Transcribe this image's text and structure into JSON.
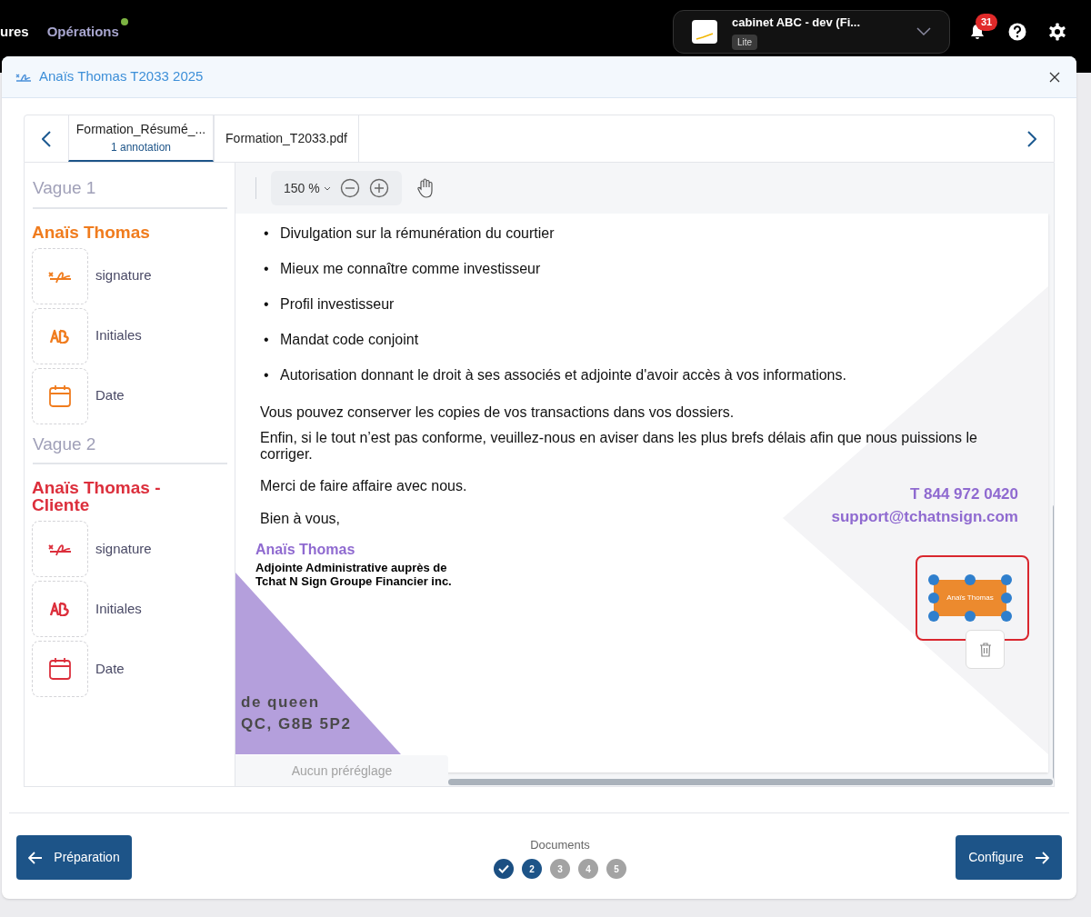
{
  "topbar": {
    "nav": [
      {
        "label": "ures",
        "dot": false
      },
      {
        "label": "Opérations",
        "dot": true
      }
    ],
    "account": {
      "name": "cabinet ABC - dev (Fi...",
      "plan": "Lite"
    },
    "notifications": "31"
  },
  "dialog": {
    "title": "Anaïs Thomas T2033 2025"
  },
  "tabs": [
    {
      "label": "Formation_Résumé_...",
      "sub": "1 annotation",
      "selected": true
    },
    {
      "label": "Formation_T2033.pdf",
      "selected": false
    }
  ],
  "waves": [
    {
      "title": "Vague 1",
      "signers": [
        {
          "name": "Anaïs Thomas",
          "color": "#f07c1e",
          "fields": [
            {
              "kind": "signature",
              "label": "signature"
            },
            {
              "kind": "initials",
              "label": "Initiales"
            },
            {
              "kind": "date",
              "label": "Date"
            }
          ]
        }
      ]
    },
    {
      "title": "Vague 2",
      "signers": [
        {
          "name": "Anaïs Thomas - Cliente",
          "color": "#dc2f3c",
          "fields": [
            {
              "kind": "signature",
              "label": "signature"
            },
            {
              "kind": "initials",
              "label": "Initiales"
            },
            {
              "kind": "date",
              "label": "Date"
            }
          ]
        }
      ]
    }
  ],
  "toolbar": {
    "zoom": "150 %"
  },
  "document": {
    "bullets": [
      {
        "marker": "•",
        "text": "Divulgation sur la rémunération du courtier"
      },
      {
        "marker": "•",
        "text": "Mieux me connaître comme investisseur"
      },
      {
        "marker": "•",
        "text": "Profil investisseur"
      },
      {
        "marker": "•",
        "text": "Mandat code conjoint"
      },
      {
        "marker": "•",
        "text": "Autorisation donnant le droit à ses associés et adjointe d'avoir accès à vos informations."
      }
    ],
    "paragraphs": [
      "Vous pouvez conserver les copies de vos transactions dans vos dossiers.",
      "Enfin, si le tout n’est pas conforme, veuillez-nous en aviser dans les plus brefs délais afin que nous puissions le corriger."
    ],
    "closing": [
      "Merci de faire affaire avec nous.",
      "Bien à vous,"
    ],
    "signer_name": "Anaïs Thomas",
    "signer_title": [
      "Adjointe Administrative auprès de",
      "Tchat N Sign Groupe Financier inc."
    ],
    "contact": [
      "T 844 972 0420",
      "support@tchatnsign.com"
    ],
    "address": [
      "de queen",
      "QC, G8B 5P2"
    ],
    "annotation": {
      "label": "Anaïs Thomas",
      "selected": true
    }
  },
  "preset": "Aucun préréglage",
  "footer": {
    "back": "Préparation",
    "next": "Configure",
    "steps_label": "Documents",
    "steps": [
      {
        "done": true,
        "selected": false
      },
      {
        "label": "2",
        "done": false,
        "selected": true
      },
      {
        "label": "3",
        "done": false,
        "selected": false
      },
      {
        "label": "4",
        "done": false,
        "selected": false
      },
      {
        "label": "5",
        "done": false,
        "selected": false
      }
    ]
  }
}
